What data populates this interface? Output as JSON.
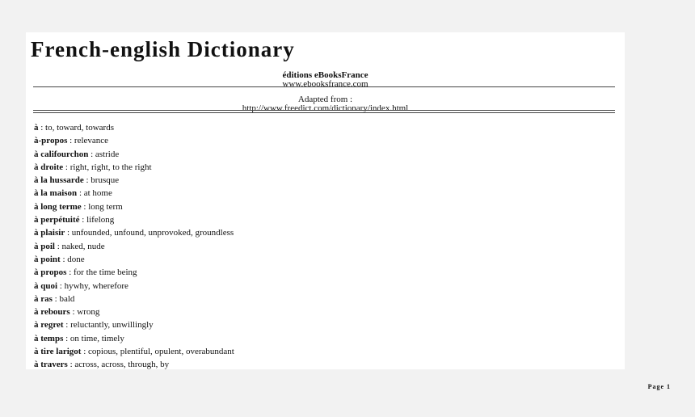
{
  "document": {
    "title": "French-english Dictionary",
    "publisher": "éditions eBooksFrance",
    "publisher_url": "www.ebooksfrance.com",
    "adapted_label": "Adapted from :",
    "source_url": "http://www.freedict.com/dictionary/index.html"
  },
  "entries": [
    {
      "term": "à",
      "definition": " : to, toward, towards"
    },
    {
      "term": "à-propos",
      "definition": " : relevance"
    },
    {
      "term": "à califourchon",
      "definition": " : astride"
    },
    {
      "term": "à droite",
      "definition": " : right, right, to the right"
    },
    {
      "term": "à la hussarde",
      "definition": " : brusque"
    },
    {
      "term": "à la maison",
      "definition": " : at home"
    },
    {
      "term": "à long terme",
      "definition": " : long term"
    },
    {
      "term": "à perpétuité",
      "definition": " : lifelong"
    },
    {
      "term": "à plaisir",
      "definition": " : unfounded, unfound, unprovoked, groundless"
    },
    {
      "term": "à poil",
      "definition": " : naked, nude"
    },
    {
      "term": "à point",
      "definition": " : done"
    },
    {
      "term": "à propos",
      "definition": " : for the time being"
    },
    {
      "term": "à quoi",
      "definition": " : hywhy, wherefore"
    },
    {
      "term": "à ras",
      "definition": " : bald"
    },
    {
      "term": "à rebours",
      "definition": " : wrong"
    },
    {
      "term": "à regret",
      "definition": " : reluctantly, unwillingly"
    },
    {
      "term": "à temps",
      "definition": " : on time, timely"
    },
    {
      "term": "à tire larigot",
      "definition": " : copious, plentiful, opulent, overabundant"
    },
    {
      "term": "à travers",
      "definition": " : across, across, through, by"
    }
  ],
  "footer": {
    "page_label": "Page 1"
  }
}
